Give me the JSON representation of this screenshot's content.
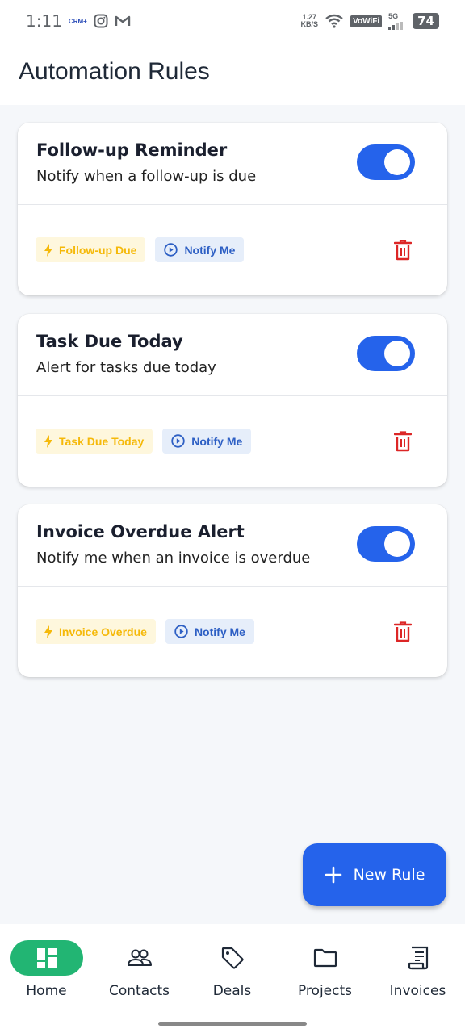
{
  "status_bar": {
    "time": "1:11",
    "mini_badge": "CRM+",
    "net_speed_top": "1.27",
    "net_speed_bottom": "KB/S",
    "vowifi": "VoWiFi",
    "network": "5G",
    "battery": "74"
  },
  "header": {
    "title": "Automation Rules"
  },
  "rules": [
    {
      "title": "Follow-up Reminder",
      "description": "Notify when a follow-up is due",
      "trigger": "Follow-up Due",
      "action": "Notify Me",
      "enabled": true
    },
    {
      "title": "Task Due Today",
      "description": "Alert for tasks due today",
      "trigger": "Task Due Today",
      "action": "Notify Me",
      "enabled": true
    },
    {
      "title": "Invoice Overdue Alert",
      "description": "Notify me when an invoice is overdue",
      "trigger": "Invoice Overdue",
      "action": "Notify Me",
      "enabled": true
    }
  ],
  "fab": {
    "label": "New Rule",
    "icon": "plus-icon"
  },
  "nav": {
    "items": [
      {
        "label": "Home",
        "icon": "dashboard-icon",
        "active": true
      },
      {
        "label": "Contacts",
        "icon": "people-icon",
        "active": false
      },
      {
        "label": "Deals",
        "icon": "tag-icon",
        "active": false
      },
      {
        "label": "Projects",
        "icon": "folder-icon",
        "active": false
      },
      {
        "label": "Invoices",
        "icon": "receipt-icon",
        "active": false
      }
    ]
  },
  "colors": {
    "primary": "#2563eb",
    "nav_active": "#22b573",
    "trigger_text": "#f5b90a",
    "trigger_bg": "#fef7dd",
    "action_text": "#2d5fc4",
    "action_bg": "#e6eefa",
    "delete": "#dc2626"
  }
}
